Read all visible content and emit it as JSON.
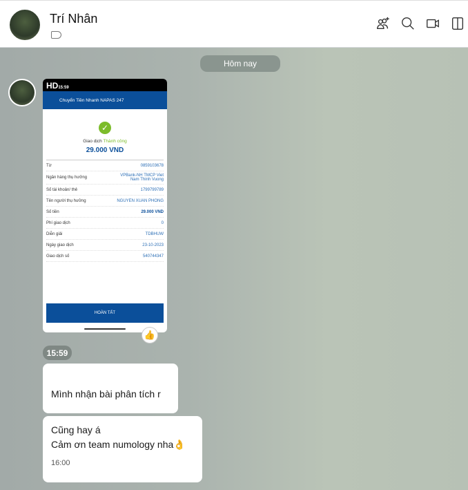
{
  "header": {
    "title": "Trí Nhân"
  },
  "date_divider": "Hôm nay",
  "receipt": {
    "status_time": "15:59",
    "hd": "HD",
    "header": "Chuyển Tiền Nhanh NAPAS 247",
    "status_prefix": "Giao dịch",
    "status_word": "Thành công",
    "amount": "29.000 VND",
    "rows": [
      {
        "label": "Từ",
        "value": "0859103678"
      },
      {
        "label": "Ngân hàng thụ hưởng",
        "value": "VPBank-NH TMCP Viet Nam Thinh Vuong"
      },
      {
        "label": "Số tài khoản/ thẻ",
        "value": "1799799789"
      },
      {
        "label": "Tên người thụ hưởng",
        "value": "NGUYEN XUAN PHONG"
      },
      {
        "label": "Số tiền",
        "value": "29.000 VND"
      },
      {
        "label": "Phí giao dịch",
        "value": "0"
      },
      {
        "label": "Diễn giải",
        "value": "TDBHUW"
      },
      {
        "label": "Ngày giao dịch",
        "value": "23-10-2023"
      },
      {
        "label": "Giao dịch số",
        "value": "540744347"
      }
    ],
    "button": "HOÀN TẤT"
  },
  "image_time": "15:59",
  "messages": [
    {
      "lines": [
        "Mình nhận bài phân tích r"
      ]
    },
    {
      "lines": [
        "Cũng hay á",
        "Cảm ơn team numology nha👌"
      ],
      "time": "16:00"
    }
  ]
}
